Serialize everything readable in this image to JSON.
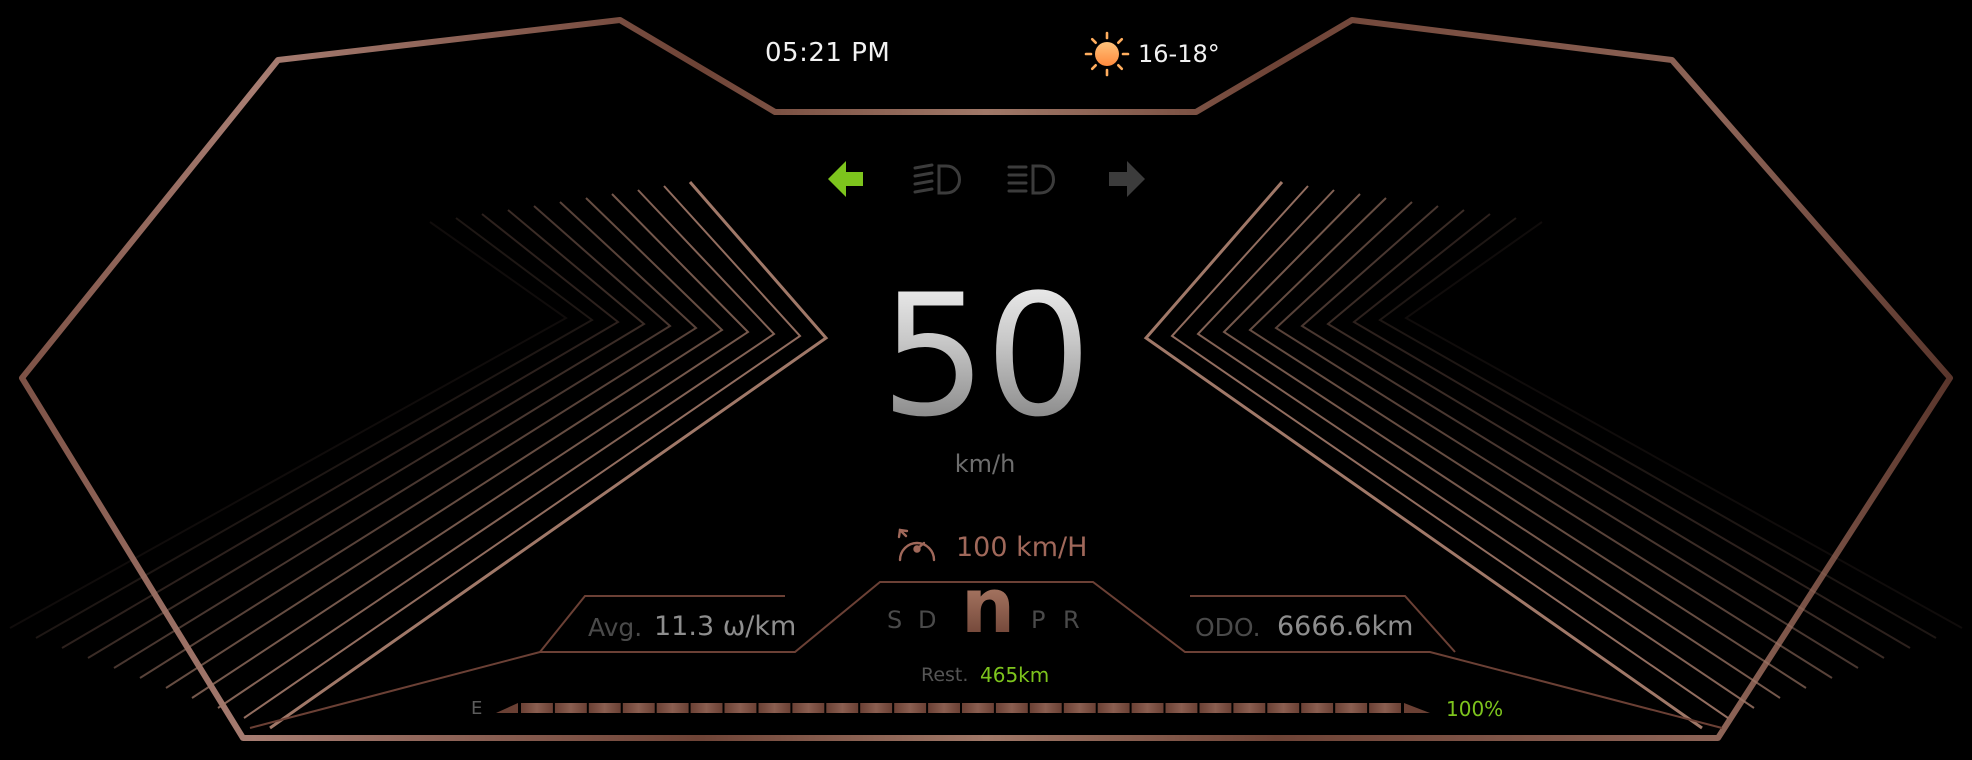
{
  "header": {
    "time": "05:21 PM",
    "temperature": "16-18°",
    "weather_icon": "sun-icon"
  },
  "indicators": {
    "left_turn": {
      "icon": "left-turn-arrow-icon",
      "active": true,
      "color": "#7dc41d"
    },
    "low_beam": {
      "icon": "low-beam-headlight-icon",
      "active": false
    },
    "high_beam": {
      "icon": "high-beam-headlight-icon",
      "active": false
    },
    "right_turn": {
      "icon": "right-turn-arrow-icon",
      "active": false
    }
  },
  "speed": {
    "value": "50",
    "unit": "km/h"
  },
  "speed_limit": {
    "icon": "cruise-speedometer-icon",
    "value": "100 km/H"
  },
  "consumption": {
    "label": "Avg.",
    "value": "11.3 ω/km"
  },
  "odometer": {
    "label": "ODO.",
    "value": "6666.6km"
  },
  "gears": {
    "items": [
      "S",
      "D",
      "n",
      "P",
      "R"
    ],
    "active": "n"
  },
  "range": {
    "label": "Rest.",
    "value": "465km"
  },
  "battery": {
    "empty_label": "E",
    "percent": "100%",
    "level": 1.0,
    "segments": 26
  },
  "colors": {
    "accent_green": "#7dc41d",
    "copper": "#a0685a",
    "inactive": "#3c3c3c",
    "background": "#000000"
  }
}
